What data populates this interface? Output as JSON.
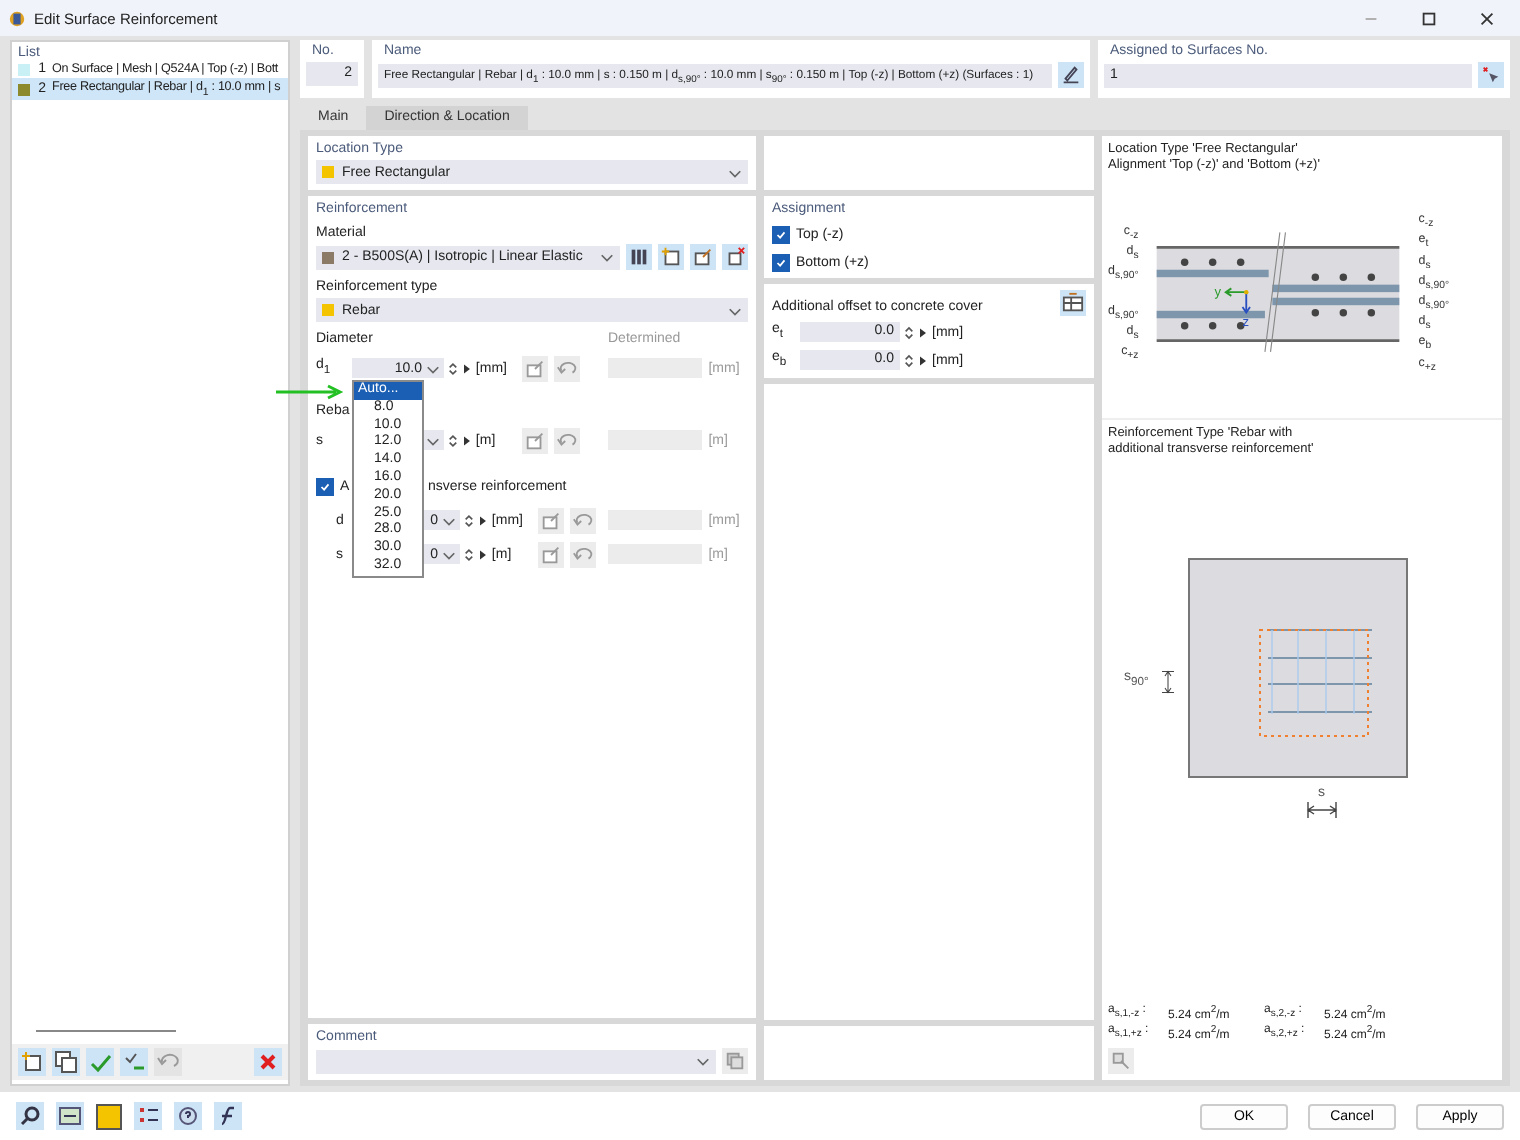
{
  "window": {
    "title": "Edit Surface Reinforcement"
  },
  "list": {
    "header": "List",
    "items": [
      {
        "number": "1",
        "text": "On Surface | Mesh | Q524A | Top (-z) | Bott",
        "color": "#c9f1f5",
        "selected": false
      },
      {
        "number": "2",
        "text": "Free Rectangular | Rebar | d$_{1}$ : 10.0 mm | s",
        "color": "#8c8a2c",
        "selected": true
      }
    ]
  },
  "number": {
    "label": "No.",
    "value": "2"
  },
  "name": {
    "label": "Name",
    "value": "Free Rectangular | Rebar | d$_{1}$ : 10.0 mm | s : 0.150 m | d$_{s,90°}$ : 10.0 mm | s$_{90°}$ : 0.150 m | Top (-z) | Bottom (+z) (Surfaces : 1)"
  },
  "assigned": {
    "label": "Assigned to Surfaces No.",
    "value": "1"
  },
  "tabs": [
    {
      "label": "Main",
      "selected": true
    },
    {
      "label": "Direction & Location",
      "selected": false
    }
  ],
  "location_type": {
    "label": "Location Type",
    "value": "Free Rectangular"
  },
  "reinforcement": {
    "header": "Reinforcement",
    "material": {
      "label": "Material",
      "value": "2 - B500S(A) | Isotropic | Linear Elastic"
    },
    "type": {
      "label": "Reinforcement type",
      "value": "Rebar"
    },
    "diameter_label": "Diameter",
    "determined_label": "Determined",
    "rows": [
      {
        "kind": "field",
        "label": "d$_{1}$",
        "value": "10.0",
        "unit": "[mm]",
        "determined_unit": "[mm]"
      },
      {
        "kind": "heading",
        "label": "Reba"
      },
      {
        "kind": "field",
        "label": "s",
        "unit": "[m]",
        "determined_unit": "[m]"
      },
      {
        "kind": "checkbox",
        "label": "A",
        "label_rest": "nsverse reinforcement",
        "checked": true
      },
      {
        "kind": "subfield",
        "label": "d",
        "value": "0",
        "unit": "[mm]",
        "determined_unit": "[mm]"
      },
      {
        "kind": "subfield",
        "label": "s",
        "value": "0",
        "unit": "[m]",
        "determined_unit": "[m]"
      }
    ],
    "dropdown": {
      "options": [
        {
          "label": "Auto...",
          "selected": true
        },
        {
          "label": "8.0",
          "selected": false
        },
        {
          "label": "10.0",
          "selected": false
        },
        {
          "label": "12.0",
          "selected": false
        },
        {
          "label": "14.0",
          "selected": false
        },
        {
          "label": "16.0",
          "selected": false
        },
        {
          "label": "20.0",
          "selected": false
        },
        {
          "label": "25.0",
          "selected": false
        },
        {
          "label": "28.0",
          "selected": false
        },
        {
          "label": "30.0",
          "selected": false
        },
        {
          "label": "32.0",
          "selected": false
        }
      ]
    }
  },
  "assignment": {
    "header": "Assignment",
    "items": [
      {
        "label": "Top (-z)",
        "checked": true
      },
      {
        "label": "Bottom (+z)",
        "checked": true
      }
    ]
  },
  "offset": {
    "header": "Additional offset to concrete cover",
    "rows": [
      {
        "label": "e$_{t}$",
        "value": "0.0",
        "unit": "[mm]"
      },
      {
        "label": "e$_{b}$",
        "value": "0.0",
        "unit": "[mm]"
      }
    ]
  },
  "comment": {
    "label": "Comment"
  },
  "location_diagram": {
    "title_lines": [
      "Location Type 'Free Rectangular'",
      "Alignment 'Top (-z)' and 'Bottom (+z)'"
    ],
    "left_labels": [
      "c$_{-z}$",
      "d$_{s}$",
      "d$_{s,90°}$",
      "d$_{s,90°}$",
      "d$_{s}$",
      "c$_{+z}$"
    ],
    "right_labels": [
      "c$_{-z}$",
      "e$_{t}$",
      "d$_{s}$",
      "d$_{s,90°}$",
      "d$_{s,90°}$",
      "d$_{s}$",
      "e$_{b}$",
      "c$_{+z}$"
    ],
    "axis_y": "y",
    "axis_z": "z"
  },
  "type_diagram": {
    "title_lines": [
      "Reinforcement Type 'Rebar with",
      "additional transverse reinforcement'"
    ],
    "spacing_90_label": "s$_{90°}$",
    "spacing_label": "s"
  },
  "areas": [
    {
      "label": "a$_{s,1,-z}$ :",
      "value": "5.24 cm$^{2}$/m"
    },
    {
      "label": "a$_{s,2,-z}$ :",
      "value": "5.24 cm$^{2}$/m"
    },
    {
      "label": "a$_{s,1,+z}$ :",
      "value": "5.24 cm$^{2}$/m"
    },
    {
      "label": "a$_{s,2,+z}$ :",
      "value": "5.24 cm$^{2}$/m"
    }
  ],
  "buttons": [
    {
      "label": "OK"
    },
    {
      "label": "Cancel"
    },
    {
      "label": "Apply"
    }
  ]
}
